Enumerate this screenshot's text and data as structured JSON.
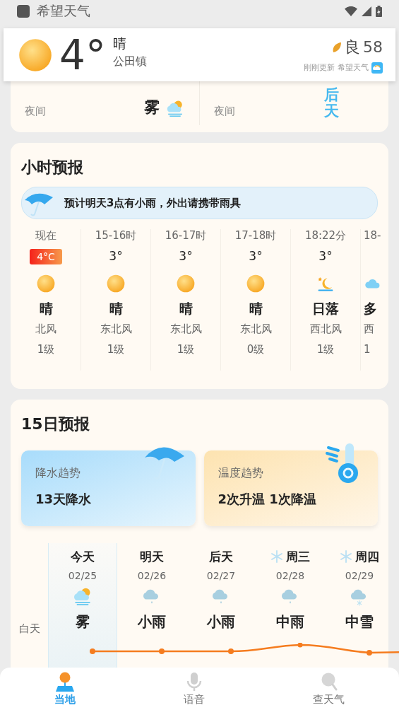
{
  "status_bar": {
    "app_name": "希望天气"
  },
  "header": {
    "temperature": "4°",
    "condition": "晴",
    "location": "公田镇",
    "aqi_label": "良",
    "aqi_value": "58",
    "updated": "刚刚更新",
    "source": "希望天气"
  },
  "today_card": {
    "left_label": "夜间",
    "left_condition": "雾",
    "right_label": "夜间",
    "overlay_text": "后天"
  },
  "hourly": {
    "title": "小时预报",
    "alert": "预计明天3点有小雨，外出请携带雨具",
    "items": [
      {
        "kind": "sun",
        "time": "现在",
        "temp": "4°C",
        "condition": "晴",
        "wind": "北风",
        "wind_level": "1级"
      },
      {
        "kind": "sun",
        "time": "15-16时",
        "temp": "3°",
        "condition": "晴",
        "wind": "东北风",
        "wind_level": "1级"
      },
      {
        "kind": "sun",
        "time": "16-17时",
        "temp": "3°",
        "condition": "晴",
        "wind": "东北风",
        "wind_level": "1级"
      },
      {
        "kind": "sun",
        "time": "17-18时",
        "temp": "3°",
        "condition": "晴",
        "wind": "东北风",
        "wind_level": "0级"
      },
      {
        "kind": "sunset",
        "time": "18:22分",
        "temp": "3°",
        "condition": "日落",
        "wind": "西北风",
        "wind_level": "1级"
      },
      {
        "kind": "cloud",
        "time": "18-",
        "condition": "多",
        "wind": "西",
        "wind_level": "1"
      }
    ]
  },
  "daily": {
    "title": "15日预报",
    "trends": [
      {
        "kind": "rain",
        "label": "降水趋势",
        "value": "13天降水"
      },
      {
        "kind": "temperature",
        "label": "温度趋势",
        "value": "2次升温 1次降温"
      }
    ],
    "row_label": "白天",
    "days": [
      {
        "kind": "fog",
        "day": "今天",
        "date": "02/25",
        "condition": "雾",
        "snow": false,
        "selected": true
      },
      {
        "kind": "rain",
        "day": "明天",
        "date": "02/26",
        "condition": "小雨",
        "snow": false,
        "selected": false
      },
      {
        "kind": "rain",
        "day": "后天",
        "date": "02/27",
        "condition": "小雨",
        "snow": false,
        "selected": false
      },
      {
        "kind": "rain",
        "day": "周三",
        "date": "02/28",
        "condition": "中雨",
        "snow": true,
        "selected": false
      },
      {
        "kind": "snow",
        "day": "周四",
        "date": "02/29",
        "condition": "中雪",
        "snow": true,
        "selected": false
      }
    ]
  },
  "nav": [
    {
      "kind": "pin",
      "label": "当地",
      "selected": true
    },
    {
      "kind": "mic",
      "label": "语音",
      "selected": false
    },
    {
      "kind": "search",
      "label": "查天气",
      "selected": false
    }
  ]
}
